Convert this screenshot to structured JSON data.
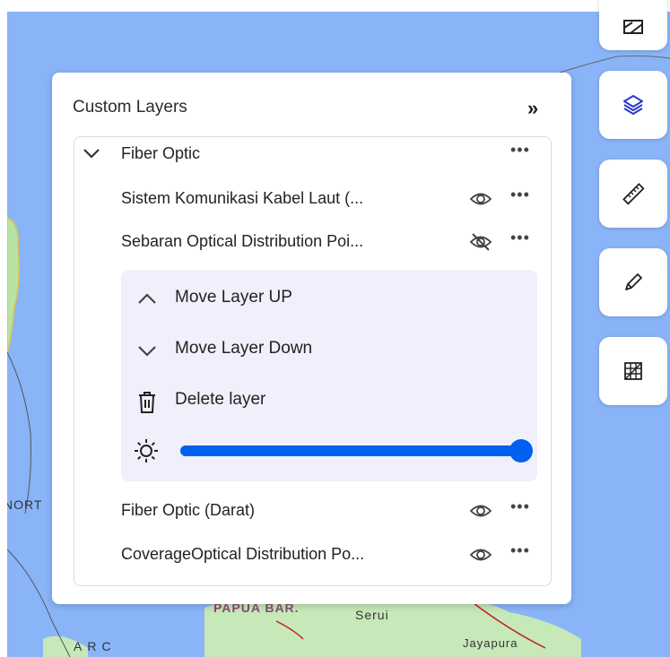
{
  "map": {
    "labels": [
      "Serui",
      "Jayapura",
      "ARC",
      "NORT",
      "PAPUA BAR."
    ]
  },
  "toolbar": {
    "buttons": [
      {
        "name": "basemap-tool-button",
        "icon": "map-layers-icon"
      },
      {
        "name": "layers-tool-button",
        "icon": "stack-layers-icon",
        "active": true
      },
      {
        "name": "ruler-tool-button",
        "icon": "ruler-icon"
      },
      {
        "name": "draw-tool-button",
        "icon": "pencil-icon"
      },
      {
        "name": "grid-tool-button",
        "icon": "grid-polygon-icon"
      }
    ],
    "accent_color": "#2a36c9"
  },
  "panel": {
    "title": "Custom Layers",
    "collapse_icon": "double-chevron-right-icon",
    "group": {
      "label": "Fiber Optic",
      "more": "•••",
      "layers": [
        {
          "label": "Sistem Komunikasi Kabel Laut (...",
          "visible": true,
          "more": "•••"
        },
        {
          "label": "Sebaran Optical Distribution Poi...",
          "visible": false,
          "more": "•••"
        },
        {
          "label": "Fiber Optic (Darat)",
          "visible": true,
          "more": "•••"
        },
        {
          "label": "CoverageOptical Distribution Po...",
          "visible": true,
          "more": "•••"
        }
      ]
    },
    "layer_menu": {
      "move_up": "Move Layer UP",
      "move_down": "Move Layer Down",
      "delete": "Delete layer",
      "opacity": 1.0,
      "slider_color": "#0060f0"
    }
  }
}
